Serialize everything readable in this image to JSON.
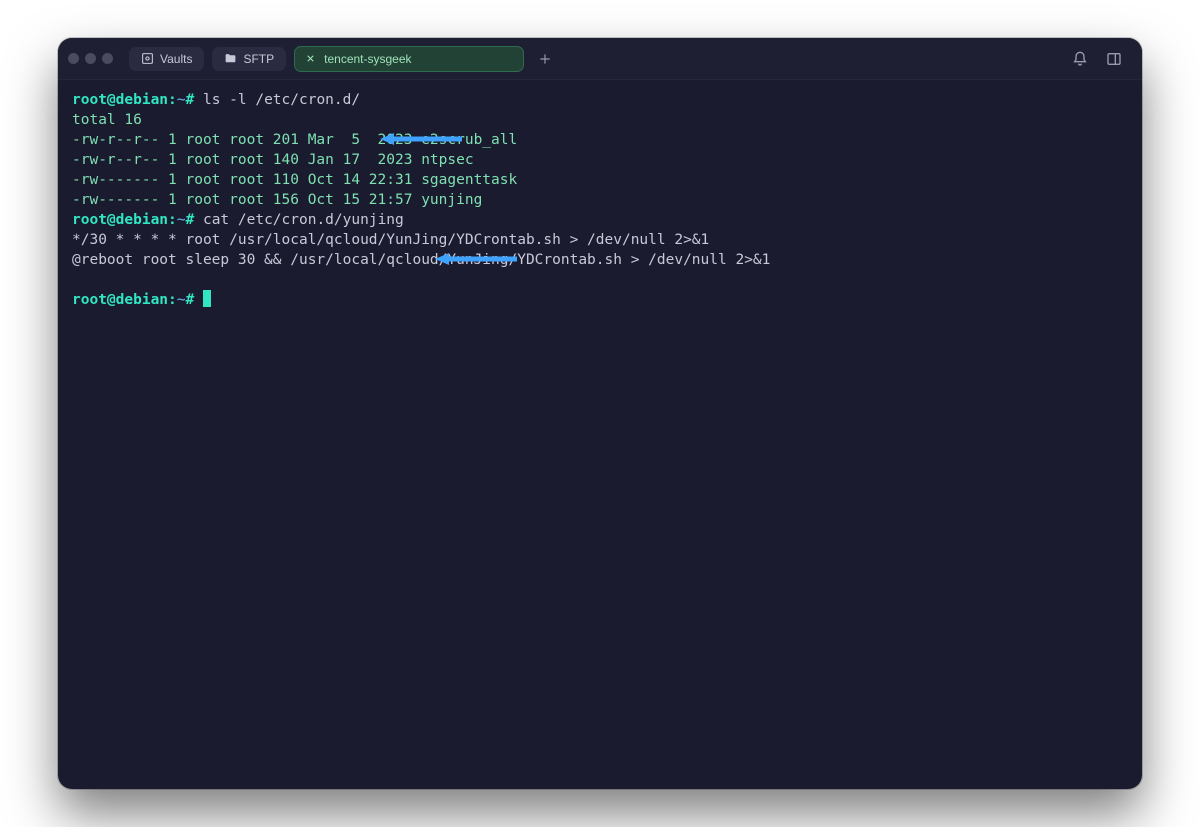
{
  "titlebar": {
    "vaults_label": "Vaults",
    "sftp_label": "SFTP",
    "active_tab": "tencent-sysgeek"
  },
  "terminal": {
    "prompt_userhost": "root@debian",
    "prompt_path": "~",
    "prompt_symbol": "#",
    "cmd1": "ls -l /etc/cron.d/",
    "ls_total": "total 16",
    "ls_lines": [
      "-rw-r--r-- 1 root root 201 Mar  5  2023 e2scrub_all",
      "-rw-r--r-- 1 root root 140 Jan 17  2023 ntpsec",
      "-rw------- 1 root root 110 Oct 14 22:31 sgagenttask",
      "-rw------- 1 root root 156 Oct 15 21:57 yunjing"
    ],
    "cmd2": "cat /etc/cron.d/yunjing",
    "cat_lines": [
      "*/30 * * * * root /usr/local/qcloud/YunJing/YDCrontab.sh > /dev/null 2>&1",
      "@reboot root sleep 30 && /usr/local/qcloud/YunJing/YDCrontab.sh > /dev/null 2>&1"
    ]
  },
  "arrows": {
    "color": "#3fa2ff"
  }
}
